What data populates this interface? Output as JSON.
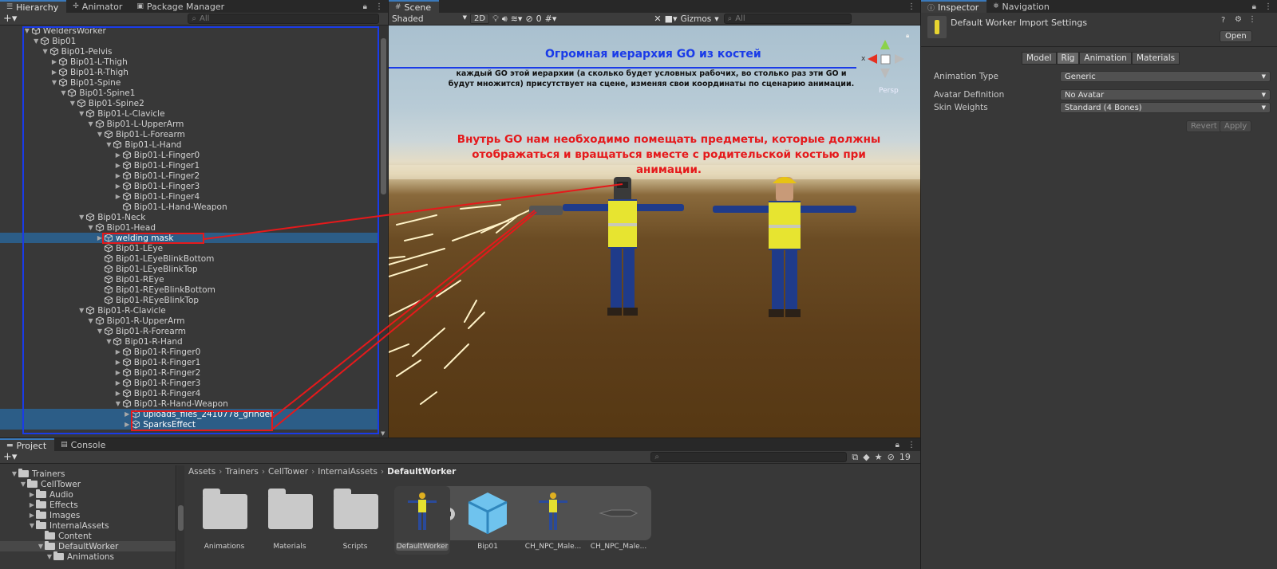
{
  "hierarchy": {
    "tabs": [
      {
        "label": "Hierarchy",
        "icon": "list-icon"
      },
      {
        "label": "Animator",
        "icon": "animator-icon"
      },
      {
        "label": "Package Manager",
        "icon": "package-icon"
      }
    ],
    "search_placeholder": "All",
    "rows": [
      {
        "label": "WeldersWorker",
        "depth": 2,
        "arrow": "▼"
      },
      {
        "label": "Bip01",
        "depth": 3,
        "arrow": "▼"
      },
      {
        "label": "Bip01-Pelvis",
        "depth": 4,
        "arrow": "▼"
      },
      {
        "label": "Bip01-L-Thigh",
        "depth": 5,
        "arrow": "▶"
      },
      {
        "label": "Bip01-R-Thigh",
        "depth": 5,
        "arrow": "▶"
      },
      {
        "label": "Bip01-Spine",
        "depth": 5,
        "arrow": "▼"
      },
      {
        "label": "Bip01-Spine1",
        "depth": 6,
        "arrow": "▼"
      },
      {
        "label": "Bip01-Spine2",
        "depth": 7,
        "arrow": "▼"
      },
      {
        "label": "Bip01-L-Clavicle",
        "depth": 8,
        "arrow": "▼"
      },
      {
        "label": "Bip01-L-UpperArm",
        "depth": 9,
        "arrow": "▼"
      },
      {
        "label": "Bip01-L-Forearm",
        "depth": 10,
        "arrow": "▼"
      },
      {
        "label": "Bip01-L-Hand",
        "depth": 11,
        "arrow": "▼"
      },
      {
        "label": "Bip01-L-Finger0",
        "depth": 12,
        "arrow": "▶"
      },
      {
        "label": "Bip01-L-Finger1",
        "depth": 12,
        "arrow": "▶"
      },
      {
        "label": "Bip01-L-Finger2",
        "depth": 12,
        "arrow": "▶"
      },
      {
        "label": "Bip01-L-Finger3",
        "depth": 12,
        "arrow": "▶"
      },
      {
        "label": "Bip01-L-Finger4",
        "depth": 12,
        "arrow": "▶"
      },
      {
        "label": "Bip01-L-Hand-Weapon",
        "depth": 12,
        "arrow": ""
      },
      {
        "label": "Bip01-Neck",
        "depth": 8,
        "arrow": "▼"
      },
      {
        "label": "Bip01-Head",
        "depth": 9,
        "arrow": "▼"
      },
      {
        "label": "welding mask",
        "depth": 10,
        "arrow": "▶",
        "selected": true
      },
      {
        "label": "Bip01-LEye",
        "depth": 10,
        "arrow": ""
      },
      {
        "label": "Bip01-LEyeBlinkBottom",
        "depth": 10,
        "arrow": ""
      },
      {
        "label": "Bip01-LEyeBlinkTop",
        "depth": 10,
        "arrow": ""
      },
      {
        "label": "Bip01-REye",
        "depth": 10,
        "arrow": ""
      },
      {
        "label": "Bip01-REyeBlinkBottom",
        "depth": 10,
        "arrow": ""
      },
      {
        "label": "Bip01-REyeBlinkTop",
        "depth": 10,
        "arrow": ""
      },
      {
        "label": "Bip01-R-Clavicle",
        "depth": 8,
        "arrow": "▼"
      },
      {
        "label": "Bip01-R-UpperArm",
        "depth": 9,
        "arrow": "▼"
      },
      {
        "label": "Bip01-R-Forearm",
        "depth": 10,
        "arrow": "▼"
      },
      {
        "label": "Bip01-R-Hand",
        "depth": 11,
        "arrow": "▼"
      },
      {
        "label": "Bip01-R-Finger0",
        "depth": 12,
        "arrow": "▶"
      },
      {
        "label": "Bip01-R-Finger1",
        "depth": 12,
        "arrow": "▶"
      },
      {
        "label": "Bip01-R-Finger2",
        "depth": 12,
        "arrow": "▶"
      },
      {
        "label": "Bip01-R-Finger3",
        "depth": 12,
        "arrow": "▶"
      },
      {
        "label": "Bip01-R-Finger4",
        "depth": 12,
        "arrow": "▶"
      },
      {
        "label": "Bip01-R-Hand-Weapon",
        "depth": 12,
        "arrow": "▼"
      },
      {
        "label": "uploads_files_2410778_grinder",
        "depth": 13,
        "arrow": "▶",
        "selected": true
      },
      {
        "label": "SparksEffect",
        "depth": 13,
        "arrow": "▶",
        "selected": true
      }
    ]
  },
  "scene": {
    "tab": "Scene",
    "shading_mode": "Shaded",
    "mode_2d": "2D",
    "hidden_count": "0",
    "gizmos_label": "Gizmos",
    "search_placeholder": "All",
    "persp_label": "Persp",
    "axis_x_label": "x",
    "annotation_title": "Огромная иерархия GO из костей",
    "annotation_body": "каждый GO этой иерархии (а сколько будет условных рабочих, во столько раз эти GO и будут множится) присутствует на сцене, изменяя свои координаты по сценарию анимации.",
    "annotation_red": "Внутрь GO нам необходимо помещать предметы, которые должны отображаться и вращаться вместе с родительской костью при анимации."
  },
  "inspector": {
    "tabs": [
      {
        "label": "Inspector",
        "icon": "info-icon"
      },
      {
        "label": "Navigation",
        "icon": "navigation-icon"
      }
    ],
    "title": "Default Worker Import Settings",
    "open_button": "Open",
    "subtabs": [
      "Model",
      "Rig",
      "Animation",
      "Materials"
    ],
    "active_subtab": "Rig",
    "fields": [
      {
        "label": "Animation Type",
        "value": "Generic"
      },
      {
        "label": "Avatar Definition",
        "value": "No Avatar"
      },
      {
        "label": "Skin Weights",
        "value": "Standard (4 Bones)"
      }
    ],
    "revert_button": "Revert",
    "apply_button": "Apply"
  },
  "project": {
    "tabs": [
      {
        "label": "Project",
        "icon": "folder-tab-icon"
      },
      {
        "label": "Console",
        "icon": "console-icon"
      }
    ],
    "hidden_count": "19",
    "breadcrumb": [
      "Assets",
      "Trainers",
      "CellTower",
      "InternalAssets",
      "DefaultWorker"
    ],
    "tree": [
      {
        "label": "Trainers",
        "depth": 1,
        "arrow": "▼"
      },
      {
        "label": "CellTower",
        "depth": 2,
        "arrow": "▼"
      },
      {
        "label": "Audio",
        "depth": 3,
        "arrow": "▶"
      },
      {
        "label": "Effects",
        "depth": 3,
        "arrow": "▶"
      },
      {
        "label": "Images",
        "depth": 3,
        "arrow": "▶"
      },
      {
        "label": "InternalAssets",
        "depth": 3,
        "arrow": "▼"
      },
      {
        "label": "Content",
        "depth": 4,
        "arrow": ""
      },
      {
        "label": "DefaultWorker",
        "depth": 4,
        "arrow": "▼",
        "selected": true
      },
      {
        "label": "Animations",
        "depth": 5,
        "arrow": "▼"
      }
    ],
    "assets": [
      {
        "label": "Animations",
        "kind": "folder"
      },
      {
        "label": "Materials",
        "kind": "folder"
      },
      {
        "label": "Scripts",
        "kind": "folder"
      },
      {
        "label": "DefaultWorker",
        "kind": "model",
        "selected": true
      },
      {
        "label": "Bip01",
        "kind": "prefab"
      },
      {
        "label": "CH_NPC_Male...",
        "kind": "model"
      },
      {
        "label": "CH_NPC_Male...",
        "kind": "mesh"
      }
    ]
  },
  "colors": {
    "accent": "#3a79bb",
    "selection": "#2c5d87",
    "annotation_blue": "#1a3be8",
    "annotation_red": "#e5191b"
  }
}
